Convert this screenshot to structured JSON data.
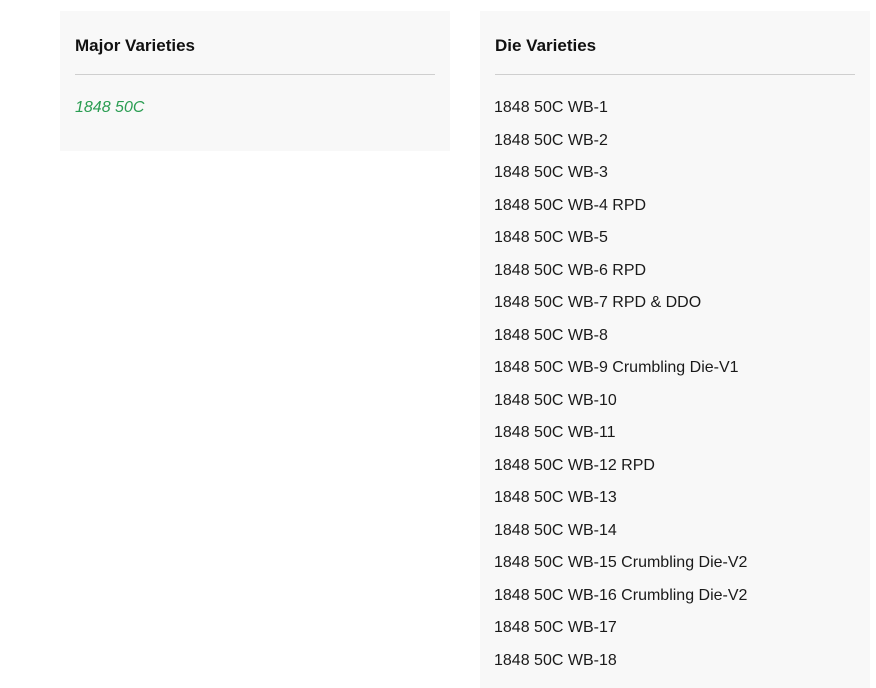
{
  "major_varieties": {
    "title": "Major Varieties",
    "items": [
      "1848 50C"
    ],
    "link_color": "#2a9d52"
  },
  "die_varieties": {
    "title": "Die Varieties",
    "items": [
      "1848 50C WB-1",
      "1848 50C WB-2",
      "1848 50C WB-3",
      "1848 50C WB-4 RPD",
      "1848 50C WB-5",
      "1848 50C WB-6 RPD",
      "1848 50C WB-7 RPD & DDO",
      "1848 50C WB-8",
      "1848 50C WB-9 Crumbling Die-V1",
      "1848 50C WB-10",
      "1848 50C WB-11",
      "1848 50C WB-12 RPD",
      "1848 50C WB-13",
      "1848 50C WB-14",
      "1848 50C WB-15 Crumbling Die-V2",
      "1848 50C WB-16 Crumbling Die-V2",
      "1848 50C WB-17",
      "1848 50C WB-18"
    ]
  },
  "colors": {
    "panel_background": "#f8f8f8",
    "divider": "#cfcfcf",
    "text": "#1a1a1a"
  }
}
